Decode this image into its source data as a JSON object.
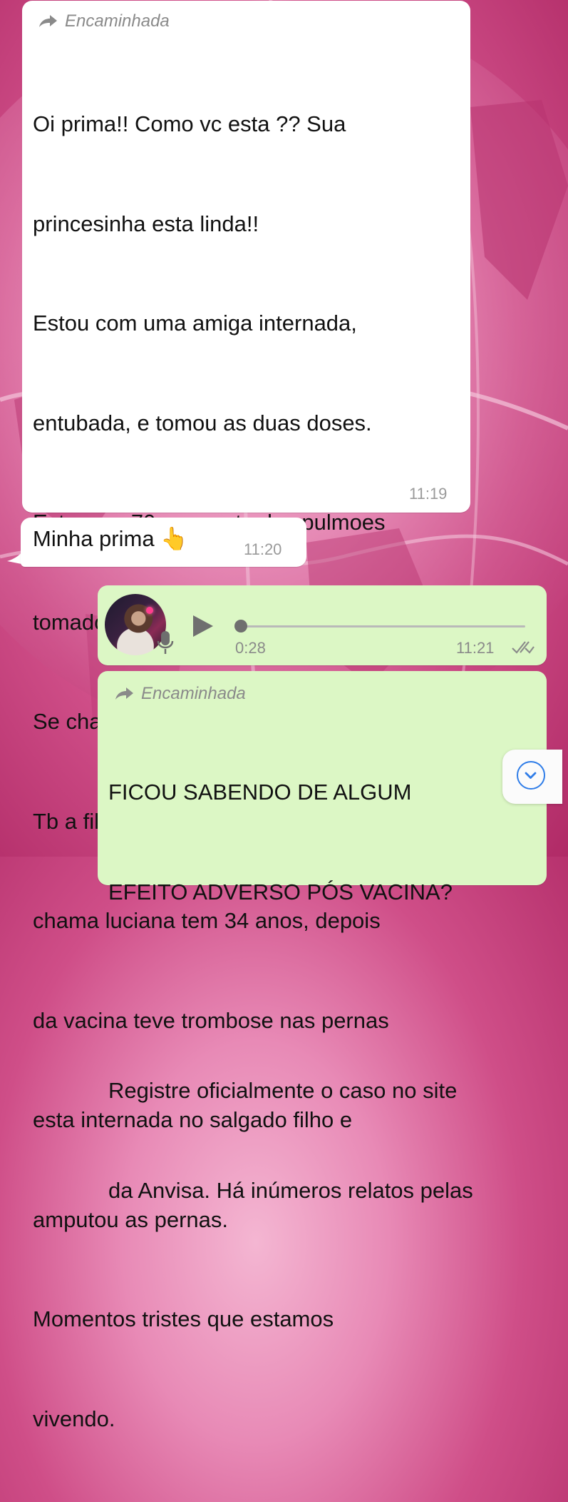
{
  "colors": {
    "incoming_bubble": "#ffffff",
    "outgoing_bubble": "#dcf7c5",
    "accent": "#2f7de8",
    "background": "#cf4e88"
  },
  "messages": [
    {
      "direction": "incoming",
      "forwarded_label": "Encaminhada",
      "lines": [
        "Oi prima!! Como vc esta ?? Sua",
        "princesinha esta linda!!",
        "Estou com uma amiga internada,",
        "entubada, e tomou as duas doses.",
        "Esta com.70 por cento dos pulmoes",
        "tomados.",
        "Se chama Adriana",
        "Tb a filha da fatima minha vizinha se",
        "chama luciana tem 34 anos, depois",
        "da vacina teve trombose nas pernas",
        "esta internada no salgado filho e",
        "amputou as pernas.",
        "Momentos tristes que estamos",
        "vivendo."
      ],
      "time": "11:19"
    },
    {
      "direction": "incoming",
      "text": "Minha prima 👆",
      "time": "11:20"
    },
    {
      "direction": "outgoing",
      "type": "voice",
      "duration": "0:28",
      "time": "11:21",
      "icons": [
        "avatar",
        "mic-icon",
        "play-icon",
        "double-check-icon"
      ]
    },
    {
      "direction": "outgoing",
      "forwarded_label": "Encaminhada",
      "lines": [
        "FICOU SABENDO DE ALGUM",
        "EFEITO ADVERSO PÓS VACINA?",
        "",
        "Registre oficialmente o caso no site",
        "da Anvisa. Há inúmeros relatos pelas"
      ]
    }
  ],
  "scroll_button": {
    "icon": "chevron-down-icon"
  }
}
